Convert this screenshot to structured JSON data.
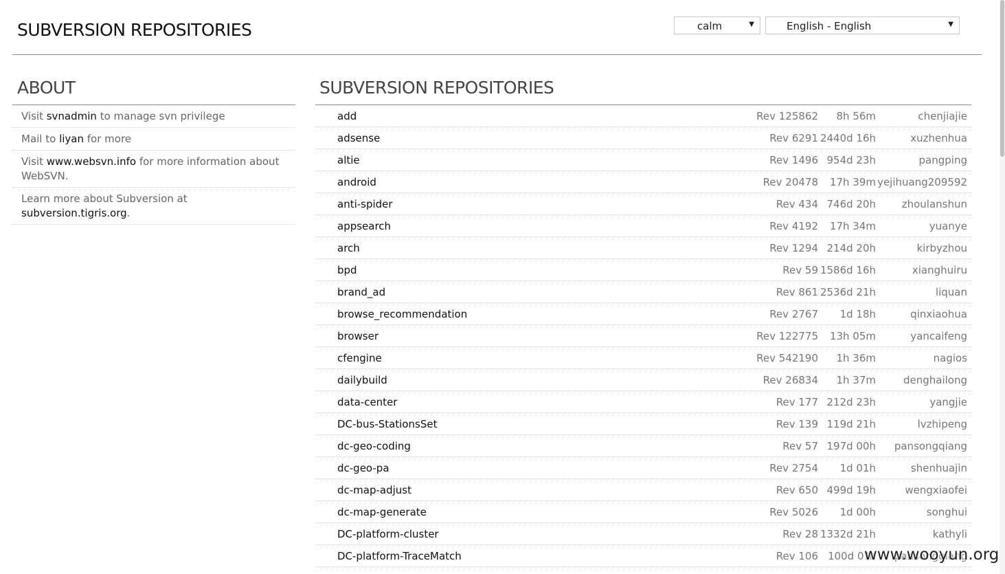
{
  "header": {
    "title": "SUBVERSION REPOSITORIES",
    "template_select": {
      "value": "calm",
      "arrow_icon": "triangle-down"
    },
    "language_select": {
      "value": "English - English",
      "arrow_icon": "triangle-down"
    }
  },
  "sidebar": {
    "heading": "ABOUT",
    "items": [
      {
        "pre": "Visit ",
        "link": "svnadmin",
        "post": " to manage svn privilege"
      },
      {
        "pre": "Mail to ",
        "link": "liyan",
        "post": " for more"
      },
      {
        "pre": "Visit ",
        "link": "www.websvn.info",
        "post": " for more information about WebSVN."
      },
      {
        "pre": "Learn more about Subversion at ",
        "link": "subversion.tigris.org",
        "post": "."
      }
    ]
  },
  "main": {
    "heading": "SUBVERSION REPOSITORIES",
    "repos": [
      {
        "name": "add",
        "rev": "Rev 125862",
        "age": "8h 56m",
        "author": "chenjiajie"
      },
      {
        "name": "adsense",
        "rev": "Rev 6291",
        "age": "2440d 16h",
        "author": "xuzhenhua"
      },
      {
        "name": "altie",
        "rev": "Rev 1496",
        "age": "954d 23h",
        "author": "pangping"
      },
      {
        "name": "android",
        "rev": "Rev 20478",
        "age": "17h 39m",
        "author": "yejihuang209592"
      },
      {
        "name": "anti-spider",
        "rev": "Rev 434",
        "age": "746d 20h",
        "author": "zhoulanshun"
      },
      {
        "name": "appsearch",
        "rev": "Rev 4192",
        "age": "17h 34m",
        "author": "yuanye"
      },
      {
        "name": "arch",
        "rev": "Rev 1294",
        "age": "214d 20h",
        "author": "kirbyzhou"
      },
      {
        "name": "bpd",
        "rev": "Rev 59",
        "age": "1586d 16h",
        "author": "xianghuiru"
      },
      {
        "name": "brand_ad",
        "rev": "Rev 861",
        "age": "2536d 21h",
        "author": "liquan"
      },
      {
        "name": "browse_recommendation",
        "rev": "Rev 2767",
        "age": "1d 18h",
        "author": "qinxiaohua"
      },
      {
        "name": "browser",
        "rev": "Rev 122775",
        "age": "13h 05m",
        "author": "yancaifeng"
      },
      {
        "name": "cfengine",
        "rev": "Rev 542190",
        "age": "1h 36m",
        "author": "nagios"
      },
      {
        "name": "dailybuild",
        "rev": "Rev 26834",
        "age": "1h 37m",
        "author": "denghailong"
      },
      {
        "name": "data-center",
        "rev": "Rev 177",
        "age": "212d 23h",
        "author": "yangjie"
      },
      {
        "name": "DC-bus-StationsSet",
        "rev": "Rev 139",
        "age": "119d 21h",
        "author": "lvzhipeng"
      },
      {
        "name": "dc-geo-coding",
        "rev": "Rev 57",
        "age": "197d 00h",
        "author": "pansongqiang"
      },
      {
        "name": "dc-geo-pa",
        "rev": "Rev 2754",
        "age": "1d 01h",
        "author": "shenhuajin"
      },
      {
        "name": "dc-map-adjust",
        "rev": "Rev 650",
        "age": "499d 19h",
        "author": "wengxiaofei"
      },
      {
        "name": "dc-map-generate",
        "rev": "Rev 5026",
        "age": "1d 00h",
        "author": "songhui"
      },
      {
        "name": "DC-platform-cluster",
        "rev": "Rev 28",
        "age": "1332d 21h",
        "author": "kathyli"
      },
      {
        "name": "DC-platform-TraceMatch",
        "rev": "Rev 106",
        "age": "100d 0?h",
        "author": "pansongqiang"
      }
    ]
  },
  "watermark": "www.wooyun.org"
}
